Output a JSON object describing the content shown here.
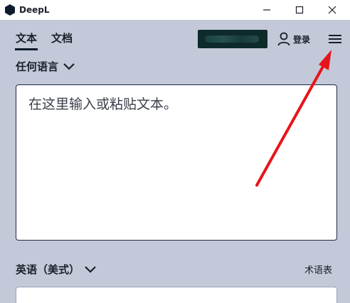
{
  "window": {
    "title": "DeepL",
    "controls": {
      "minimize_icon": "minimize-icon",
      "maximize_icon": "maximize-icon",
      "close_icon": "close-icon"
    }
  },
  "nav": {
    "tabs": [
      {
        "label": "文本",
        "active": true
      },
      {
        "label": "文档",
        "active": false
      }
    ],
    "login_label": "登录",
    "login_icon": "user-icon",
    "menu_icon": "hamburger-menu-icon"
  },
  "source": {
    "language_label": "任何语言",
    "placeholder": "在这里输入或粘贴文本。"
  },
  "target": {
    "language_label": "英语（美式）",
    "glossary_label": "术语表"
  },
  "colors": {
    "background": "#c3c9d8",
    "titlebar": "#ffffff",
    "box_border": "#1f2a44",
    "annotation_arrow": "#e8141a"
  }
}
